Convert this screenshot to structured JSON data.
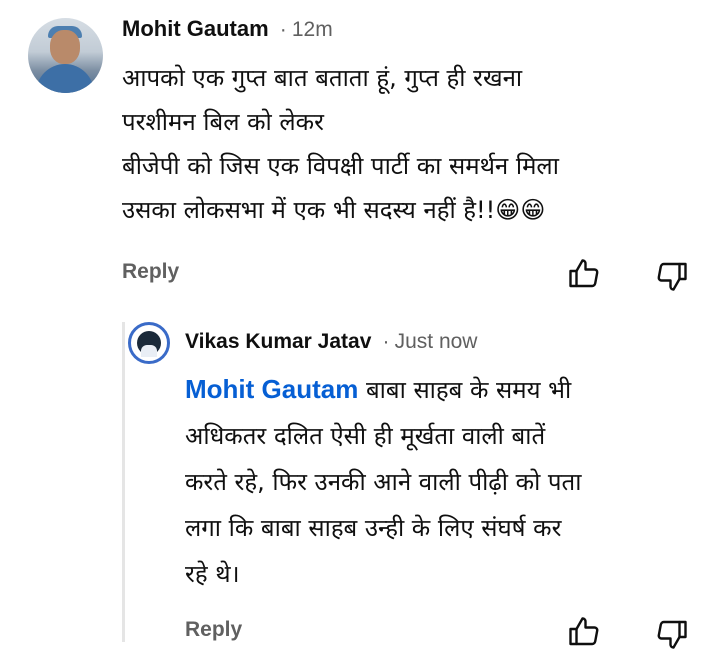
{
  "comment": {
    "author": "Mohit Gautam",
    "separator": "·",
    "time": "12m",
    "lines": [
      "आपको एक गुप्त बात बताता हूं, गुप्त ही रखना",
      "परशीमन बिल को लेकर",
      "बीजेपी को जिस एक विपक्षी पार्टी का समर्थन मिला",
      "उसका लोकसभा में एक भी सदस्य नहीं है!!"
    ],
    "emoji": "😁😁",
    "reply_label": "Reply",
    "avatar_icon": "user-photo-avatar",
    "like_icon": "thumbs-up-icon",
    "dislike_icon": "thumbs-down-icon"
  },
  "reply": {
    "author": "Vikas Kumar Jatav",
    "separator": "·",
    "time": "Just now",
    "mention": "Mohit Gautam",
    "first_line_rest": " बाबा साहब के समय भी",
    "lines": [
      "अधिकतर दलित ऐसी ही मूर्खता वाली बातें",
      "करते रहे, फिर उनकी आने वाली पीढ़ी को पता",
      "लगा कि बाबा साहब उन्ही के लिए संघर्ष कर",
      "रहे थे।"
    ],
    "reply_label": "Reply"
  },
  "colors": {
    "mention": "#065fd4",
    "secondary_text": "#606060",
    "thread_line": "#e5e5e5"
  }
}
